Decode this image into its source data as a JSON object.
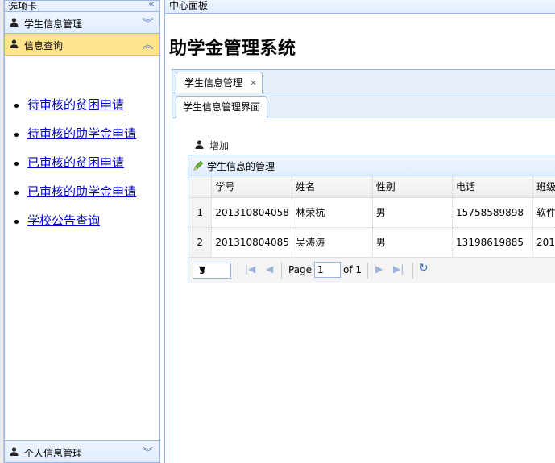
{
  "west": {
    "title": "选项卡",
    "sections": [
      {
        "label": "学生信息管理",
        "arrow": "⌄⌄"
      },
      {
        "label": "信息查询",
        "arrow": "⌃⌃"
      },
      {
        "label": "个人信息管理",
        "arrow": "⌄⌄"
      }
    ],
    "links": [
      "待审核的贫困申请",
      "待审核的助学金申请",
      "已审核的贫困申请",
      "已审核的助学金申请",
      "学校公告查询"
    ]
  },
  "center": {
    "title": "中心面板",
    "system_title": "助学金管理系统",
    "tab_label": "学生信息管理",
    "tab_close": "×",
    "inner_tab_label": "学生信息管理界面"
  },
  "toolbar": {
    "add_label": "增加"
  },
  "grid": {
    "title": "学生信息的管理",
    "columns": [
      "学号",
      "姓名",
      "性别",
      "电话",
      "班级"
    ],
    "rows": [
      {
        "rn": "1",
        "cells": [
          "201310804058",
          "林荣杭",
          "男",
          "15758589898",
          "软件"
        ]
      },
      {
        "rn": "2",
        "cells": [
          "201310804085",
          "吴涛涛",
          "男",
          "13198619885",
          "201"
        ]
      }
    ]
  },
  "pager": {
    "page_size": "5",
    "page_label": "Page",
    "page_value": "1",
    "of_label": "of 1"
  },
  "colors": {
    "border": "#95b8e7",
    "header_bg": "#e0ecff",
    "selected": "#ffe48d",
    "link": "#0000cc"
  }
}
